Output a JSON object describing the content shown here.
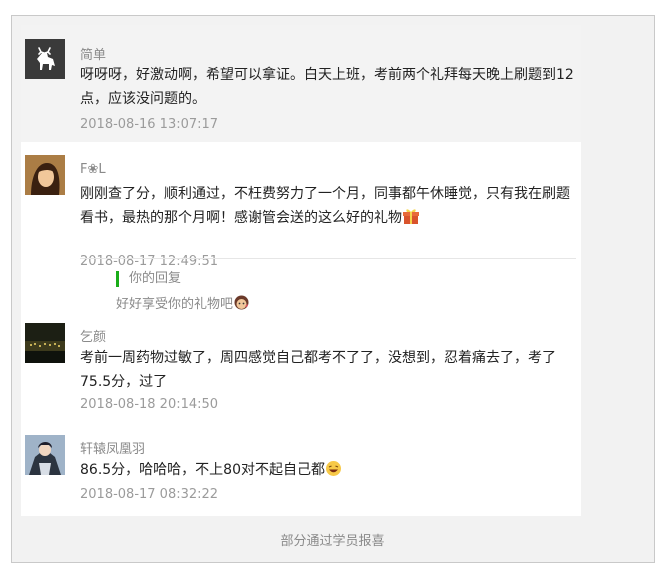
{
  "comments": [
    {
      "name": "简单",
      "text": "呀呀呀，好激动啊，希望可以拿证。白天上班，考前两个礼拜每天晚上刷题到12点，应该没问题的。",
      "time": "2018-08-16 13:07:17",
      "avatar_icon": "deer-logo-avatar"
    },
    {
      "name": "F❀L",
      "text": "刚刚查了分，顺利通过，不枉费努力了一个月，同事都午休睡觉，只有我在刷题看书，最热的那个月啊！感谢管会送的这么好的礼物",
      "time": "2018-08-17 12:49:51",
      "avatar_icon": "woman-portrait-avatar",
      "emoji": "gift-emoji"
    },
    {
      "name": "乞颜",
      "text": "考前一周药物过敏了，周四感觉自己都考不了了，没想到，忍着痛去了，考了75.5分，过了",
      "time": "2018-08-18 20:14:50",
      "avatar_icon": "night-scene-avatar"
    },
    {
      "name": "轩辕凤凰羽",
      "text": "86.5分，哈哈哈，不上80对不起自己都",
      "time": "2018-08-17 08:32:22",
      "avatar_icon": "anime-character-avatar",
      "emoji": "laughing-emoji"
    }
  ],
  "reply": {
    "label": "你的回复",
    "text": "好好享受你的礼物吧",
    "emoji": "kiss-emoji"
  },
  "caption": "部分通过学员报喜",
  "colors": {
    "accent_bar": "#1aad19",
    "frame_bg": "#f2f2f2",
    "highlight_bg": "#f3f3f3"
  }
}
